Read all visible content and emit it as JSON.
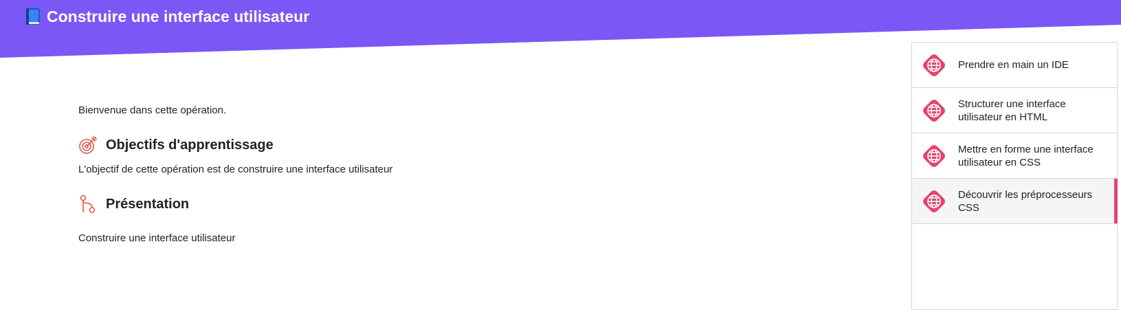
{
  "header": {
    "title": "Construire une interface utilisateur",
    "icon": "book-icon",
    "background_color": "#7b57f5"
  },
  "main": {
    "intro": "Bienvenue dans cette opération.",
    "objectives": {
      "title": "Objectifs d'apprentissage",
      "icon": "target-icon",
      "text": "L'objectif de cette opération est de construire une interface utilisateur"
    },
    "presentation": {
      "title": "Présentation",
      "icon": "branch-icon",
      "text": "Construire une interface utilisateur"
    }
  },
  "sidebar": {
    "accent_color": "#e2456d",
    "items": [
      {
        "label": "Prendre en main un IDE",
        "icon": "globe-icon",
        "active": false
      },
      {
        "label": "Structurer une interface utilisateur en HTML",
        "icon": "globe-icon",
        "active": false
      },
      {
        "label": "Mettre en forme une interface utilisateur en CSS",
        "icon": "globe-icon",
        "active": false
      },
      {
        "label": "Découvrir les préprocesseurs CSS",
        "icon": "globe-icon",
        "active": true
      }
    ]
  }
}
